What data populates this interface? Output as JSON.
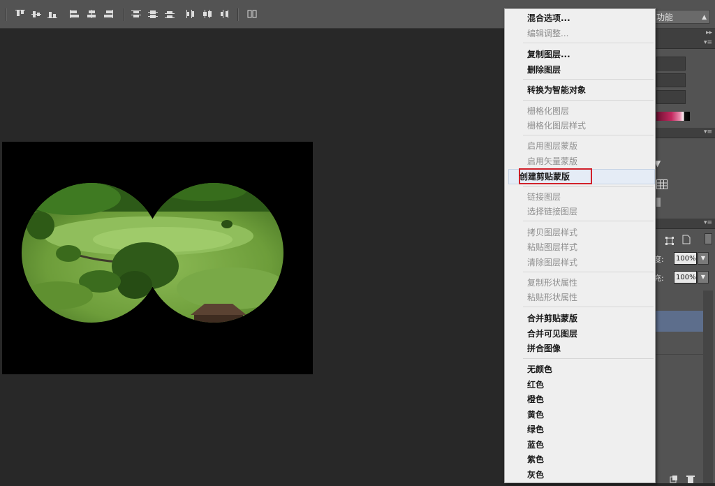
{
  "workspace": {
    "label": "功能"
  },
  "context_menu": {
    "items": [
      {
        "label": "混合选项...",
        "enabled": true
      },
      {
        "label": "编辑调整...",
        "enabled": false
      },
      {
        "label": "复制图层...",
        "enabled": true
      },
      {
        "label": "删除图层",
        "enabled": true
      },
      {
        "label": "转换为智能对象",
        "enabled": true
      },
      {
        "label": "栅格化图层",
        "enabled": false
      },
      {
        "label": "栅格化图层样式",
        "enabled": false
      },
      {
        "label": "启用图层蒙版",
        "enabled": false
      },
      {
        "label": "启用矢量蒙版",
        "enabled": false
      },
      {
        "label": "创建剪贴蒙版",
        "enabled": true,
        "highlighted": true
      },
      {
        "label": "链接图层",
        "enabled": false
      },
      {
        "label": "选择链接图层",
        "enabled": false
      },
      {
        "label": "拷贝图层样式",
        "enabled": false
      },
      {
        "label": "粘贴图层样式",
        "enabled": false
      },
      {
        "label": "清除图层样式",
        "enabled": false
      },
      {
        "label": "复制形状属性",
        "enabled": false
      },
      {
        "label": "粘贴形状属性",
        "enabled": false
      },
      {
        "label": "合并剪贴蒙版",
        "enabled": true
      },
      {
        "label": "合并可见图层",
        "enabled": true
      },
      {
        "label": "拼合图像",
        "enabled": true
      },
      {
        "label": "无颜色",
        "enabled": true
      },
      {
        "label": "红色",
        "enabled": true
      },
      {
        "label": "橙色",
        "enabled": true
      },
      {
        "label": "黄色",
        "enabled": true
      },
      {
        "label": "绿色",
        "enabled": true
      },
      {
        "label": "蓝色",
        "enabled": true
      },
      {
        "label": "紫色",
        "enabled": true
      },
      {
        "label": "灰色",
        "enabled": true
      }
    ]
  },
  "layers_panel": {
    "opacity_label": "度:",
    "opacity_value": "100%",
    "fill_label": "充:",
    "fill_value": "100%"
  },
  "colors": {
    "highlight_border": "#d1212b",
    "selected_layer": "#5d6e8c",
    "menu_bg": "#efefef"
  }
}
